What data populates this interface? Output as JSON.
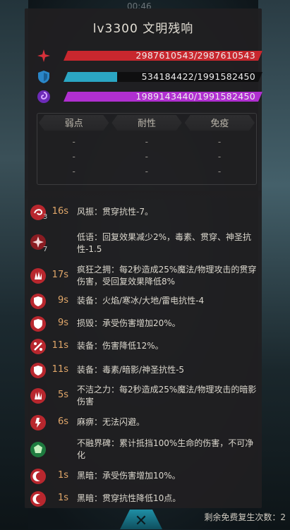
{
  "background": {
    "top_counter": "00:46"
  },
  "panel": {
    "title": "lv3300 文明残响",
    "bars": [
      {
        "name": "health",
        "icon": "health-cross-icon",
        "text": "2987610543/2987610543",
        "fill": 1.0,
        "color": "#c8272e"
      },
      {
        "name": "shield",
        "icon": "shield-icon",
        "text": "534184422/1991582450",
        "fill": 0.268,
        "color": "#2ba6c3"
      },
      {
        "name": "energy",
        "icon": "spiral-energy-icon",
        "text": "1989143440/1991582450",
        "fill": 0.999,
        "color": "#b02fd0"
      }
    ],
    "resistance": {
      "headers": [
        "弱点",
        "耐性",
        "免疫"
      ],
      "rows": [
        [
          "-",
          "-",
          "-"
        ],
        [
          "-",
          "-",
          "-"
        ],
        [
          "-",
          "-",
          "-"
        ]
      ]
    },
    "effects": [
      {
        "icon": "wind-vortex-icon",
        "stack": "3",
        "duration": "16s",
        "text": "风振：贯穿抗性-7。",
        "color": "#b8272e"
      },
      {
        "icon": "whisper-sparkle-icon",
        "stack": "7",
        "duration": "",
        "text": "低语：回复效果减少2%，毒素、贯穿、神圣抗性-1.5",
        "color": "#8a1c22"
      },
      {
        "icon": "claw-flame-icon",
        "stack": "",
        "duration": "17s",
        "text": "疯狂之拥：每2秒造成25%魔法/物理攻击的贯穿伤害，受回复效果降低8%",
        "color": "#b8272e"
      },
      {
        "icon": "shield-icon",
        "stack": "",
        "duration": "9s",
        "text": "装备：火焰/寒冰/大地/雷电抗性-4",
        "color": "#b8272e"
      },
      {
        "icon": "shield-icon",
        "stack": "",
        "duration": "9s",
        "text": "损毁：承受伤害增加20%。",
        "color": "#b8272e"
      },
      {
        "icon": "percent-down-icon",
        "stack": "",
        "duration": "11s",
        "text": "装备：伤害降低12%。",
        "color": "#b8272e"
      },
      {
        "icon": "shield-icon",
        "stack": "",
        "duration": "11s",
        "text": "装备：毒素/暗影/神圣抗性-5",
        "color": "#b8272e"
      },
      {
        "icon": "claw-flame-icon",
        "stack": "",
        "duration": "5s",
        "text": "不洁之力：每2秒造成25%魔法/物理攻击的暗影伤害",
        "color": "#b8272e"
      },
      {
        "icon": "paralysis-icon",
        "stack": "",
        "duration": "6s",
        "text": "麻痹：无法闪避。",
        "color": "#b8272e"
      },
      {
        "icon": "green-barrier-icon",
        "stack": "",
        "duration": "",
        "text": "不融界碑：累计抵挡100%生命的伤害，不可净化",
        "color": "#1e7b3f"
      },
      {
        "icon": "dark-crescent-icon",
        "stack": "",
        "duration": "1s",
        "text": "黑暗：承受伤害增加10%。",
        "color": "#b8272e"
      },
      {
        "icon": "dark-crescent-icon",
        "stack": "",
        "duration": "1s",
        "text": "黑暗：贯穿抗性降低10点。",
        "color": "#b8272e"
      }
    ]
  },
  "footer": {
    "revive_text": "剩余免费复生次数：2",
    "close_icon": "close-icon"
  }
}
